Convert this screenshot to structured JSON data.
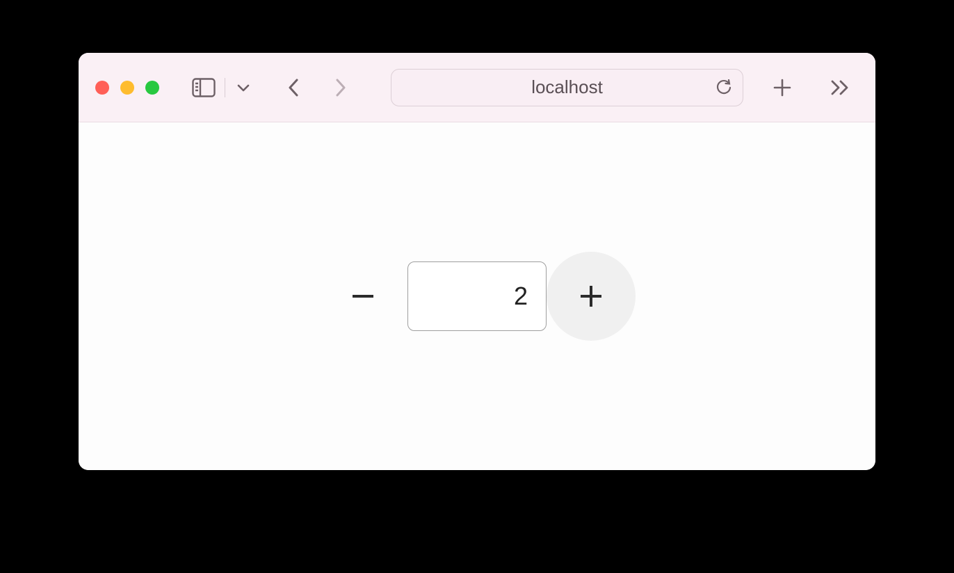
{
  "browser": {
    "address": "localhost"
  },
  "stepper": {
    "value": "2"
  }
}
